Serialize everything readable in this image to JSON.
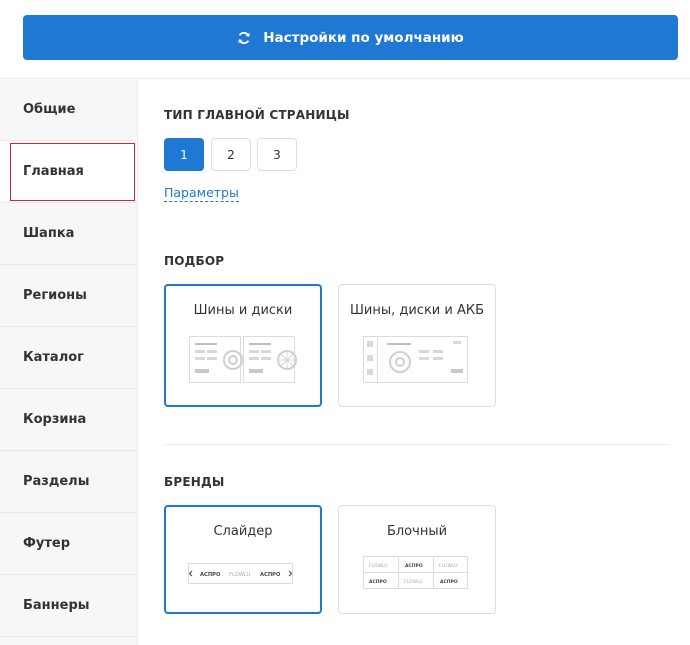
{
  "toolbar": {
    "reset_label": "Настройки по умолчанию",
    "reset_icon": "refresh-icon"
  },
  "sidebar": {
    "items": [
      {
        "label": "Общие"
      },
      {
        "label": "Главная"
      },
      {
        "label": "Шапка"
      },
      {
        "label": "Регионы"
      },
      {
        "label": "Каталог"
      },
      {
        "label": "Корзина"
      },
      {
        "label": "Разделы"
      },
      {
        "label": "Футер"
      },
      {
        "label": "Баннеры"
      }
    ],
    "active_index": 1
  },
  "main": {
    "home_type": {
      "title": "ТИП ГЛАВНОЙ СТРАНИЦЫ",
      "options": [
        "1",
        "2",
        "3"
      ],
      "selected": "1",
      "params_link": "Параметры"
    },
    "selection": {
      "title": "ПОДБОР",
      "options": [
        {
          "label": "Шины и диски",
          "selected": true
        },
        {
          "label": "Шины, диски и АКБ",
          "selected": false
        }
      ]
    },
    "brands": {
      "title": "БРЕНДЫ",
      "options": [
        {
          "label": "Слайдер",
          "selected": true
        },
        {
          "label": "Блочный",
          "selected": false
        }
      ],
      "logo_texts": [
        "АСПРО",
        "FLOWLU"
      ]
    }
  },
  "colors": {
    "accent": "#1f78d1",
    "highlight": "#d6262a",
    "sidebar_bg": "#f7f7f7"
  }
}
